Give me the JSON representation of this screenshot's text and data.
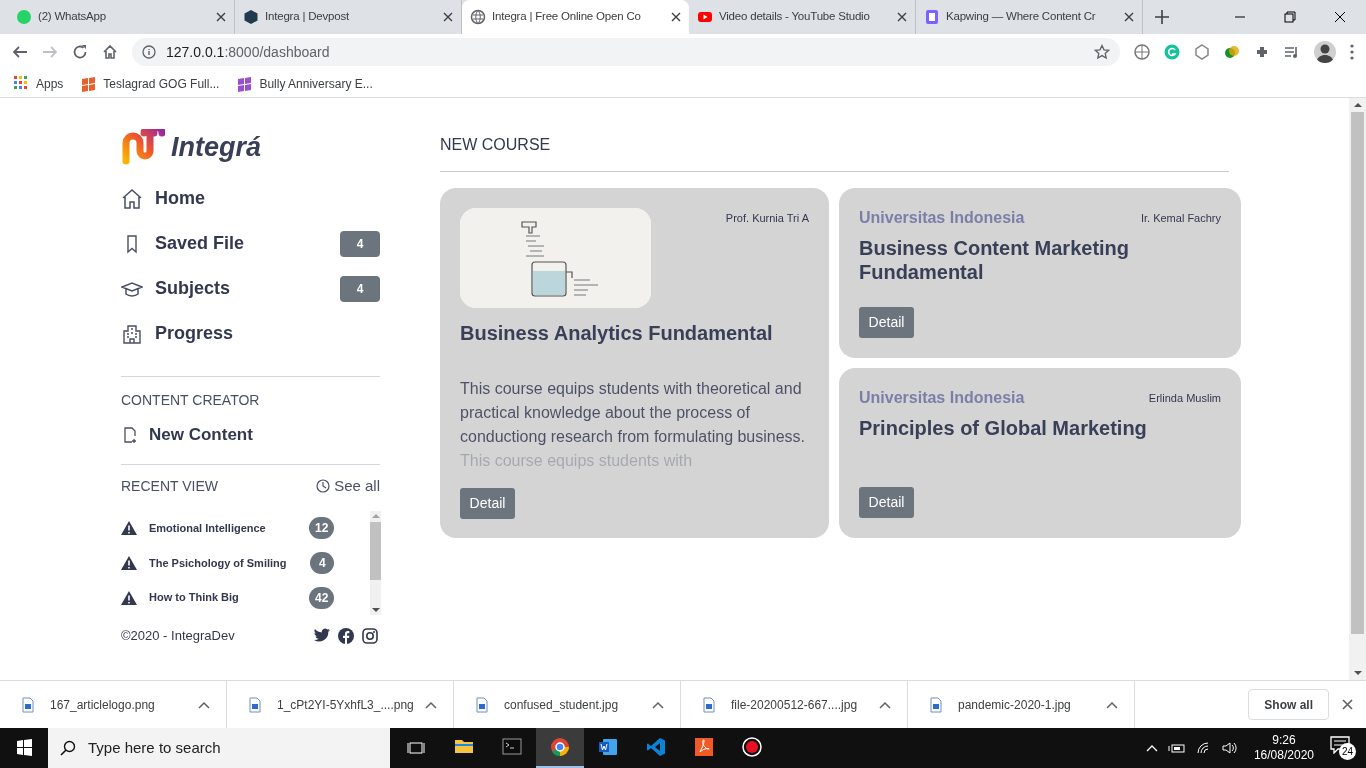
{
  "browser": {
    "tabs": [
      {
        "title": "(2) WhatsApp",
        "selected": false
      },
      {
        "title": "Integra | Devpost",
        "selected": false
      },
      {
        "title": "Integra | Free Online Open Co",
        "selected": true
      },
      {
        "title": "Video details - YouTube Studio",
        "selected": false
      },
      {
        "title": "Kapwing — Where Content Cr",
        "selected": false
      }
    ],
    "address_host": "127.0.0.1",
    "address_path": ":8000/dashboard",
    "bookmarks": [
      "Apps",
      "Teslagrad GOG Full...",
      "Bully Anniversary E..."
    ]
  },
  "sidebar": {
    "logo": "Integrá",
    "nav": [
      {
        "label": "Home"
      },
      {
        "label": "Saved File",
        "count": "4"
      },
      {
        "label": "Subjects",
        "count": "4"
      },
      {
        "label": "Progress"
      }
    ],
    "creator_heading": "CONTENT CREATOR",
    "creator_items": [
      "New Content"
    ],
    "recent_heading": "RECENT VIEW",
    "see_all": "See all",
    "recent": [
      {
        "title": "Emotional Intelligence",
        "count": "12"
      },
      {
        "title": "The Psichology of Smiling",
        "count": "4"
      },
      {
        "title": "How to Think Big",
        "count": "42"
      }
    ],
    "copyright": "©2020 - IntegraDev"
  },
  "main": {
    "heading": "NEW COURSE",
    "courses": [
      {
        "kind": "featured",
        "instructor": "Prof. Kurnia Tri A",
        "title": "Business Analytics Fundamental",
        "description": "This course equips students with theoretical and practical knowledge about the process of conductiong research from formulating business. This course equips students with",
        "button": "Detail"
      },
      {
        "kind": "compact",
        "university": "Universitas Indonesia",
        "instructor": "Ir. Kemal Fachry",
        "title": "Business Content Marketing Fundamental",
        "button": "Detail"
      },
      {
        "kind": "compact",
        "university": "Universitas Indonesia",
        "instructor": "Erlinda Muslim",
        "title": "Principles of Global Marketing",
        "button": "Detail"
      }
    ]
  },
  "downloads": {
    "files": [
      "167_articlelogo.png",
      "1_cPt2YI-5YxhfL3_....png",
      "confused_student.jpg",
      "file-20200512-667....jpg",
      "pandemic-2020-1.jpg"
    ],
    "show_all": "Show all"
  },
  "taskbar": {
    "search_placeholder": "Type here to search",
    "apps": [
      {
        "selected": false
      },
      {
        "selected": false
      },
      {
        "selected": true
      },
      {
        "selected": false
      },
      {
        "selected": false
      },
      {
        "selected": false
      },
      {
        "selected": false
      }
    ],
    "time": "9:26",
    "date": "16/08/2020",
    "notifications": "24"
  }
}
